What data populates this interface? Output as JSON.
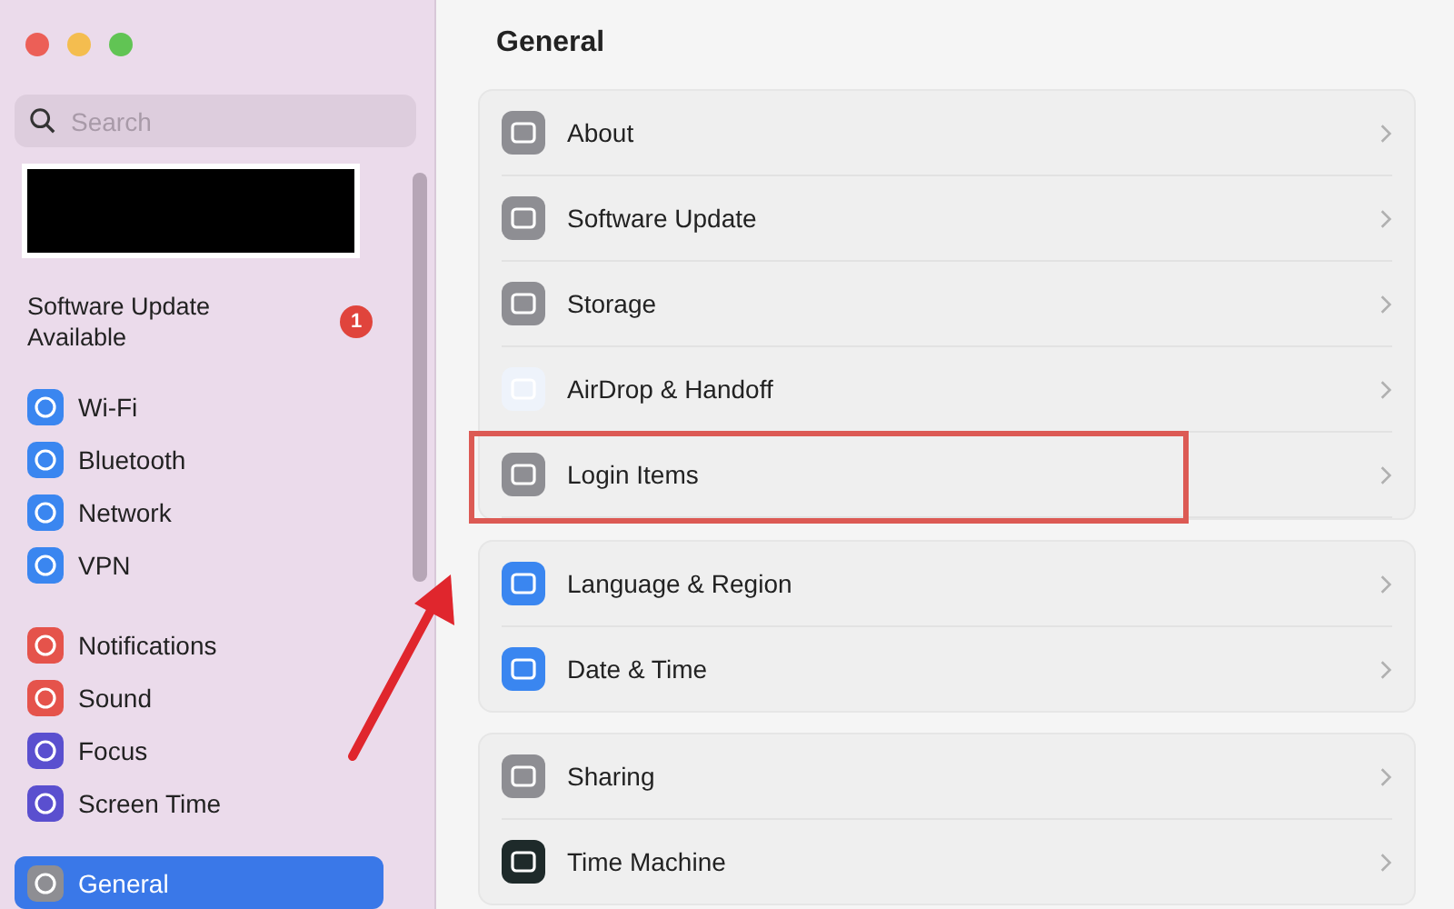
{
  "window": {
    "title": "General"
  },
  "sidebar": {
    "search": {
      "placeholder": "Search"
    },
    "update_notice": {
      "text": "Software Update Available",
      "badge": "1"
    },
    "sections": [
      {
        "items": [
          {
            "label": "Wi-Fi",
            "selected": false
          },
          {
            "label": "Bluetooth",
            "selected": false
          },
          {
            "label": "Network",
            "selected": false
          },
          {
            "label": "VPN",
            "selected": false
          }
        ]
      },
      {
        "items": [
          {
            "label": "Notifications",
            "selected": false
          },
          {
            "label": "Sound",
            "selected": false
          },
          {
            "label": "Focus",
            "selected": false
          },
          {
            "label": "Screen Time",
            "selected": false
          }
        ]
      },
      {
        "items": [
          {
            "label": "General",
            "selected": true
          }
        ]
      }
    ]
  },
  "groups": [
    {
      "rows": [
        {
          "label": "About",
          "highlighted": false
        },
        {
          "label": "Software Update",
          "highlighted": false
        },
        {
          "label": "Storage",
          "highlighted": false
        },
        {
          "label": "AirDrop & Handoff",
          "highlighted": false
        },
        {
          "label": "Login Items",
          "highlighted": true
        }
      ]
    },
    {
      "rows": [
        {
          "label": "Language & Region",
          "highlighted": false
        },
        {
          "label": "Date & Time",
          "highlighted": false
        }
      ]
    },
    {
      "rows": [
        {
          "label": "Sharing",
          "highlighted": false
        },
        {
          "label": "Time Machine",
          "highlighted": false
        }
      ]
    }
  ],
  "arrow_annotation": true
}
